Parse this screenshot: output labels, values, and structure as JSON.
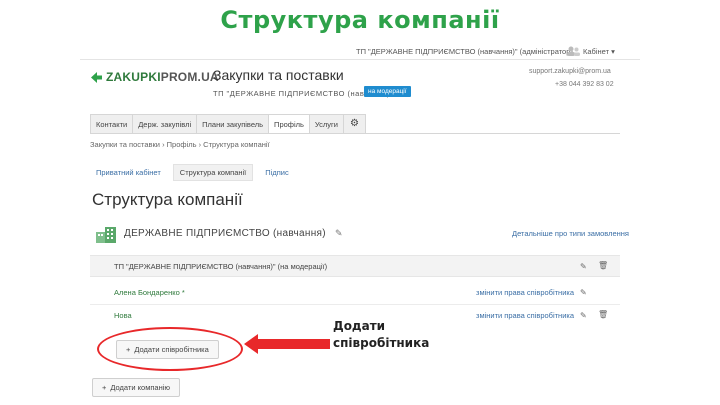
{
  "slide": {
    "title": "Структура компанії",
    "callout": [
      "Додати",
      "співробітника"
    ]
  },
  "topbar": {
    "org_label": "ТП \"ДЕРЖАВНЕ ПІДПРИЄМСТВО (навчання)\" (адміністратор)",
    "cabinet_label": "Кабінет ▾"
  },
  "header": {
    "logo_a": "ZAKUPKI",
    "logo_b": "PROM.UA",
    "title": "Закупки та поставки",
    "org": "ТП \"ДЕРЖАВНЕ ПІДПРИЄМСТВО (навчання)\"",
    "badge": "на модерації",
    "email": "support.zakupki@prom.ua",
    "phone": "+38 044 392 83 02"
  },
  "tabs": [
    {
      "label": "Контакти"
    },
    {
      "label": "Держ. закупівлі"
    },
    {
      "label": "Плани закупівель"
    },
    {
      "label": "Профіль",
      "active": true
    },
    {
      "label": "Услуги"
    }
  ],
  "breadcrumb": "Закупки та поставки › Профіль › Структура компанії",
  "subnav": [
    {
      "label": "Приватний кабінет"
    },
    {
      "label": "Структура компанії",
      "selected": true
    },
    {
      "label": "Підпис"
    }
  ],
  "page_title": "Структура компанії",
  "company": {
    "name": "ДЕРЖАВНЕ ПІДПРИЄМСТВО (навчання)",
    "details_link": "Детальніше про типи замовлення",
    "row_label": "ТП \"ДЕРЖАВНЕ ПІДПРИЄМСТВО (навчання)\" (на модерації)"
  },
  "employees": [
    {
      "name": "Алена Бондаренко *",
      "rights": "змінити права співробітника"
    },
    {
      "name": "Нова",
      "rights": "змінити права співробітника"
    }
  ],
  "buttons": {
    "add_employee": "Додати співробітника",
    "add_company": "Додати компанію"
  },
  "colors": {
    "title_green": "#2ea24a",
    "brand_green": "#2f7a3c",
    "link_blue": "#3a6ea5",
    "badge_blue": "#1f8ccf",
    "callout_red": "#e8282a"
  }
}
